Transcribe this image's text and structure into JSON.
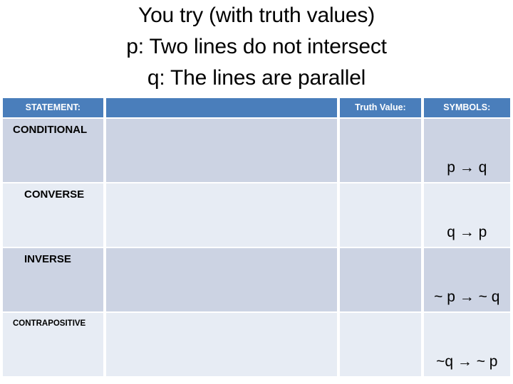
{
  "slide": {
    "title_lines": [
      "You try (with truth values)",
      "p: Two lines do not intersect",
      "q: The lines are parallel"
    ]
  },
  "colors": {
    "header_blue": "#4a7ebb",
    "band_dark": "#ccd3e3",
    "band_light": "#e7ecf4",
    "text": "#000000",
    "header_text": "#ffffff"
  },
  "table": {
    "headers": {
      "statement": "STATEMENT:",
      "blank": "",
      "truth_value": "Truth Value:",
      "symbols": "SYMBOLS:"
    },
    "rows": [
      {
        "statement": "CONDITIONAL",
        "statement_text": "",
        "truth_value": "",
        "symbols": "p → q"
      },
      {
        "statement": "CONVERSE",
        "statement_text": "",
        "truth_value": "",
        "symbols": "q → p"
      },
      {
        "statement": "INVERSE",
        "statement_text": "",
        "truth_value": "",
        "symbols": "~ p → ~ q"
      },
      {
        "statement": "CONTRAPOSITIVE",
        "statement_text": "",
        "truth_value": "",
        "symbols": "~q → ~ p"
      }
    ]
  }
}
